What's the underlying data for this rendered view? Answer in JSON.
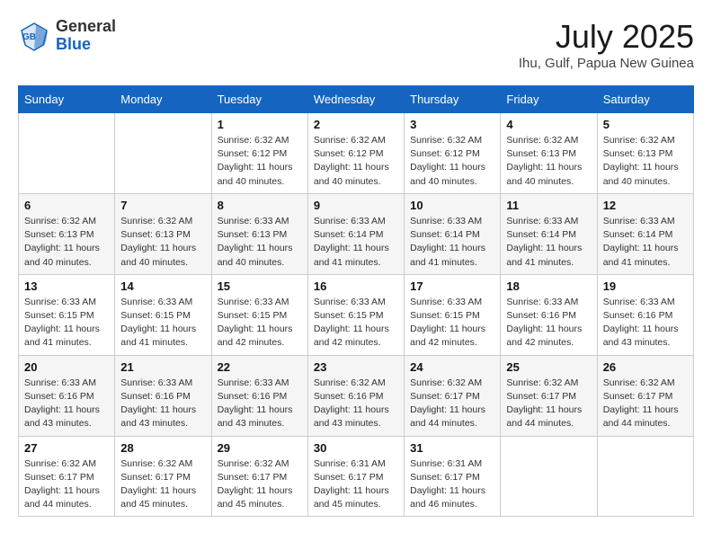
{
  "header": {
    "logo_line1": "General",
    "logo_line2": "Blue",
    "month_year": "July 2025",
    "location": "Ihu, Gulf, Papua New Guinea"
  },
  "days_of_week": [
    "Sunday",
    "Monday",
    "Tuesday",
    "Wednesday",
    "Thursday",
    "Friday",
    "Saturday"
  ],
  "weeks": [
    [
      {
        "day": "",
        "info": ""
      },
      {
        "day": "",
        "info": ""
      },
      {
        "day": "1",
        "info": "Sunrise: 6:32 AM\nSunset: 6:12 PM\nDaylight: 11 hours and 40 minutes."
      },
      {
        "day": "2",
        "info": "Sunrise: 6:32 AM\nSunset: 6:12 PM\nDaylight: 11 hours and 40 minutes."
      },
      {
        "day": "3",
        "info": "Sunrise: 6:32 AM\nSunset: 6:12 PM\nDaylight: 11 hours and 40 minutes."
      },
      {
        "day": "4",
        "info": "Sunrise: 6:32 AM\nSunset: 6:13 PM\nDaylight: 11 hours and 40 minutes."
      },
      {
        "day": "5",
        "info": "Sunrise: 6:32 AM\nSunset: 6:13 PM\nDaylight: 11 hours and 40 minutes."
      }
    ],
    [
      {
        "day": "6",
        "info": "Sunrise: 6:32 AM\nSunset: 6:13 PM\nDaylight: 11 hours and 40 minutes."
      },
      {
        "day": "7",
        "info": "Sunrise: 6:32 AM\nSunset: 6:13 PM\nDaylight: 11 hours and 40 minutes."
      },
      {
        "day": "8",
        "info": "Sunrise: 6:33 AM\nSunset: 6:13 PM\nDaylight: 11 hours and 40 minutes."
      },
      {
        "day": "9",
        "info": "Sunrise: 6:33 AM\nSunset: 6:14 PM\nDaylight: 11 hours and 41 minutes."
      },
      {
        "day": "10",
        "info": "Sunrise: 6:33 AM\nSunset: 6:14 PM\nDaylight: 11 hours and 41 minutes."
      },
      {
        "day": "11",
        "info": "Sunrise: 6:33 AM\nSunset: 6:14 PM\nDaylight: 11 hours and 41 minutes."
      },
      {
        "day": "12",
        "info": "Sunrise: 6:33 AM\nSunset: 6:14 PM\nDaylight: 11 hours and 41 minutes."
      }
    ],
    [
      {
        "day": "13",
        "info": "Sunrise: 6:33 AM\nSunset: 6:15 PM\nDaylight: 11 hours and 41 minutes."
      },
      {
        "day": "14",
        "info": "Sunrise: 6:33 AM\nSunset: 6:15 PM\nDaylight: 11 hours and 41 minutes."
      },
      {
        "day": "15",
        "info": "Sunrise: 6:33 AM\nSunset: 6:15 PM\nDaylight: 11 hours and 42 minutes."
      },
      {
        "day": "16",
        "info": "Sunrise: 6:33 AM\nSunset: 6:15 PM\nDaylight: 11 hours and 42 minutes."
      },
      {
        "day": "17",
        "info": "Sunrise: 6:33 AM\nSunset: 6:15 PM\nDaylight: 11 hours and 42 minutes."
      },
      {
        "day": "18",
        "info": "Sunrise: 6:33 AM\nSunset: 6:16 PM\nDaylight: 11 hours and 42 minutes."
      },
      {
        "day": "19",
        "info": "Sunrise: 6:33 AM\nSunset: 6:16 PM\nDaylight: 11 hours and 43 minutes."
      }
    ],
    [
      {
        "day": "20",
        "info": "Sunrise: 6:33 AM\nSunset: 6:16 PM\nDaylight: 11 hours and 43 minutes."
      },
      {
        "day": "21",
        "info": "Sunrise: 6:33 AM\nSunset: 6:16 PM\nDaylight: 11 hours and 43 minutes."
      },
      {
        "day": "22",
        "info": "Sunrise: 6:33 AM\nSunset: 6:16 PM\nDaylight: 11 hours and 43 minutes."
      },
      {
        "day": "23",
        "info": "Sunrise: 6:32 AM\nSunset: 6:16 PM\nDaylight: 11 hours and 43 minutes."
      },
      {
        "day": "24",
        "info": "Sunrise: 6:32 AM\nSunset: 6:17 PM\nDaylight: 11 hours and 44 minutes."
      },
      {
        "day": "25",
        "info": "Sunrise: 6:32 AM\nSunset: 6:17 PM\nDaylight: 11 hours and 44 minutes."
      },
      {
        "day": "26",
        "info": "Sunrise: 6:32 AM\nSunset: 6:17 PM\nDaylight: 11 hours and 44 minutes."
      }
    ],
    [
      {
        "day": "27",
        "info": "Sunrise: 6:32 AM\nSunset: 6:17 PM\nDaylight: 11 hours and 44 minutes."
      },
      {
        "day": "28",
        "info": "Sunrise: 6:32 AM\nSunset: 6:17 PM\nDaylight: 11 hours and 45 minutes."
      },
      {
        "day": "29",
        "info": "Sunrise: 6:32 AM\nSunset: 6:17 PM\nDaylight: 11 hours and 45 minutes."
      },
      {
        "day": "30",
        "info": "Sunrise: 6:31 AM\nSunset: 6:17 PM\nDaylight: 11 hours and 45 minutes."
      },
      {
        "day": "31",
        "info": "Sunrise: 6:31 AM\nSunset: 6:17 PM\nDaylight: 11 hours and 46 minutes."
      },
      {
        "day": "",
        "info": ""
      },
      {
        "day": "",
        "info": ""
      }
    ]
  ]
}
